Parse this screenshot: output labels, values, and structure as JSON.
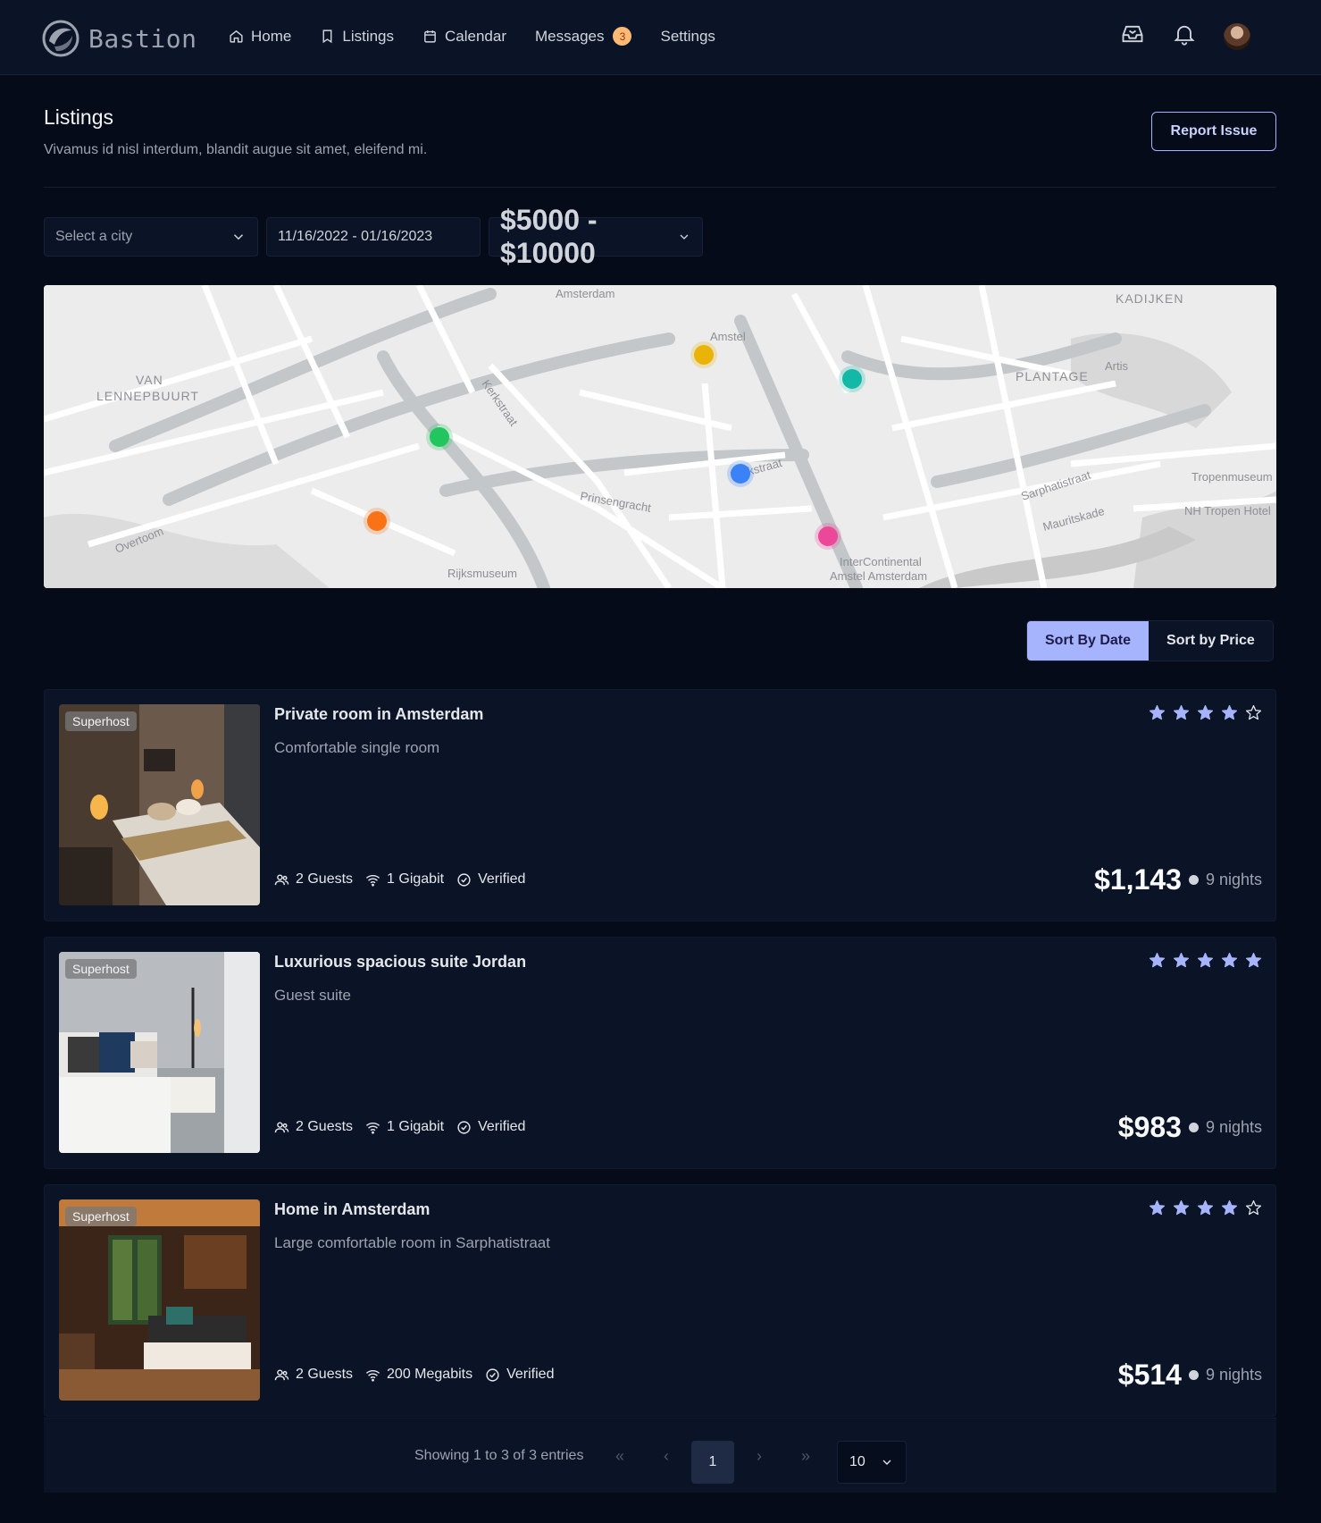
{
  "brand": {
    "name": "Bastion"
  },
  "nav": [
    {
      "label": "Home",
      "icon": "home-icon"
    },
    {
      "label": "Listings",
      "icon": "bookmark-icon"
    },
    {
      "label": "Calendar",
      "icon": "calendar-icon"
    },
    {
      "label": "Messages",
      "badge": "3"
    },
    {
      "label": "Settings"
    }
  ],
  "header": {
    "title": "Listings",
    "subtitle": "Vivamus id nisl interdum, blandit augue sit amet, eleifend mi.",
    "report_label": "Report Issue"
  },
  "filters": {
    "city_placeholder": "Select a city",
    "date_range": "11/16/2022 - 01/16/2023",
    "price_range": "$5000 - $10000"
  },
  "map": {
    "labels": [
      "Amsterdam",
      "Amstel",
      "KADIJKEN",
      "Artis",
      "PLANTAGE",
      "VAN",
      "LENNEPBUURT",
      "Kerkstraat",
      "Kerkstraat",
      "Prinsengracht",
      "Sarphatistraat",
      "Tropenmuseum",
      "NH Tropen Hotel",
      "Mauritskade",
      "Overtoom",
      "Rijksmuseum",
      "InterContinental",
      "Amstel Amsterdam"
    ],
    "markers": [
      {
        "color": "#eab308"
      },
      {
        "color": "#14b8a6"
      },
      {
        "color": "#22c55e"
      },
      {
        "color": "#3b82f6"
      },
      {
        "color": "#f97316"
      },
      {
        "color": "#ec4899"
      }
    ]
  },
  "sort": {
    "by_date": "Sort By Date",
    "by_price": "Sort by Price"
  },
  "listings": [
    {
      "badge": "Superhost",
      "title": "Private room in Amsterdam",
      "description": "Comfortable single room",
      "guests": "2 Guests",
      "internet": "1 Gigabit",
      "verified": "Verified",
      "rating": 4,
      "price": "$1,143",
      "nights": "9 nights"
    },
    {
      "badge": "Superhost",
      "title": "Luxurious spacious suite Jordan",
      "description": "Guest suite",
      "guests": "2 Guests",
      "internet": "1 Gigabit",
      "verified": "Verified",
      "rating": 5,
      "price": "$983",
      "nights": "9 nights"
    },
    {
      "badge": "Superhost",
      "title": "Home in Amsterdam",
      "description": "Large comfortable room in Sarphatistraat",
      "guests": "2 Guests",
      "internet": "200 Megabits",
      "verified": "Verified",
      "rating": 4,
      "price": "$514",
      "nights": "9 nights"
    }
  ],
  "pagination": {
    "summary": "Showing 1 to 3 of 3 entries",
    "current_page": "1",
    "per_page": "10",
    "first": "«",
    "prev": "‹",
    "next": "›",
    "last": "»"
  },
  "colors": {
    "accent": "#a5b4fc",
    "star": "#a5b4fc",
    "background": "#050b18",
    "card": "#0a1426"
  }
}
